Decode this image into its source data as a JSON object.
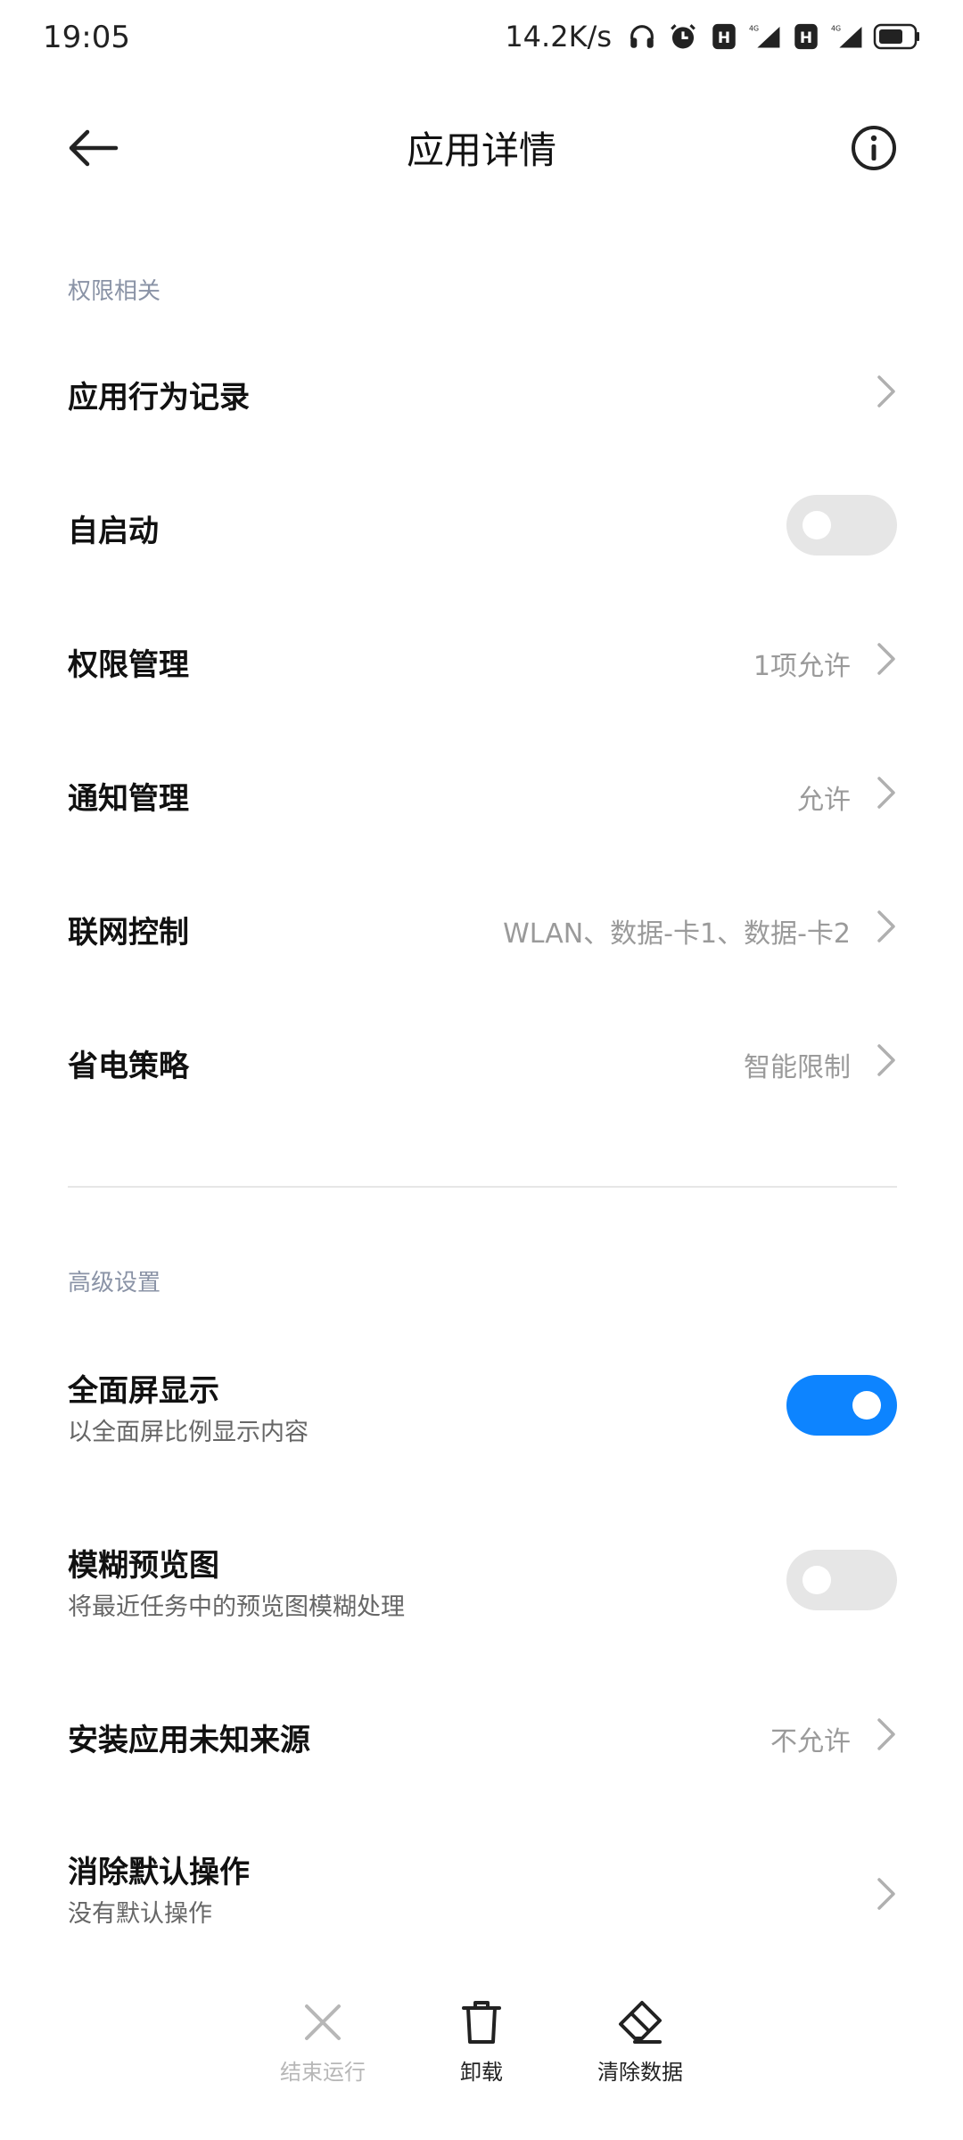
{
  "status_bar": {
    "time": "19:05",
    "net_speed": "14.2K/s",
    "icons": [
      "headphones-icon",
      "alarm-icon",
      "hd-icon",
      "signal-4g-icon",
      "hd-icon",
      "signal-4g-icon",
      "battery-icon"
    ],
    "network_label_1": "4G",
    "network_label_2": "4G",
    "hd_label": "H"
  },
  "header": {
    "title": "应用详情",
    "back_icon": "arrow-left-icon",
    "info_icon": "info-icon"
  },
  "permissions": {
    "section_label": "权限相关",
    "items": [
      {
        "title": "应用行为记录",
        "value": ""
      },
      {
        "title": "自启动",
        "toggle": false
      },
      {
        "title": "权限管理",
        "value": "1项允许"
      },
      {
        "title": "通知管理",
        "value": "允许"
      },
      {
        "title": "联网控制",
        "value": "WLAN、数据-卡1、数据-卡2"
      },
      {
        "title": "省电策略",
        "value": "智能限制"
      }
    ]
  },
  "advanced": {
    "section_label": "高级设置",
    "items": [
      {
        "title": "全面屏显示",
        "subtitle": "以全面屏比例显示内容",
        "toggle": true
      },
      {
        "title": "模糊预览图",
        "subtitle": "将最近任务中的预览图模糊处理",
        "toggle": false
      },
      {
        "title": "安装应用未知来源",
        "value": "不允许"
      },
      {
        "title": "消除默认操作",
        "subtitle": "没有默认操作"
      }
    ]
  },
  "actions": [
    {
      "label": "结束运行",
      "icon": "close-icon",
      "enabled": false
    },
    {
      "label": "卸载",
      "icon": "trash-icon",
      "enabled": true
    },
    {
      "label": "清除数据",
      "icon": "eraser-icon",
      "enabled": true
    }
  ],
  "colors": {
    "accent": "#0d84ff",
    "section_label": "#8a93a6",
    "value_text": "#9a9a9a"
  }
}
